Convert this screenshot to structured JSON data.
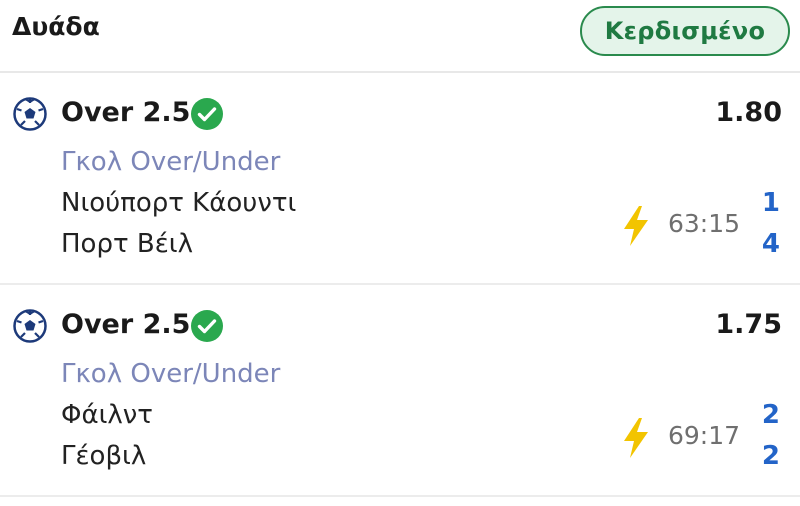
{
  "header": {
    "title": "Δυάδα",
    "status": "Κερδισμένο"
  },
  "colors": {
    "status_green": "#1f7a42",
    "check_green": "#2aa84e",
    "market_text": "#7c86b8",
    "score_blue": "#2364c8",
    "bolt_yellow": "#f2c400"
  },
  "bets": [
    {
      "sport_icon": "soccer-ball-icon",
      "selection": "Over 2.5",
      "result_icon": "check-circle-icon",
      "odds": "1.80",
      "market": "Γκολ Over/Under",
      "home_team": "Νιούπορτ Κάουντι",
      "away_team": "Πορτ Βέιλ",
      "live_icon": "lightning-icon",
      "time": "63:15",
      "home_score": "1",
      "away_score": "4"
    },
    {
      "sport_icon": "soccer-ball-icon",
      "selection": "Over 2.5",
      "result_icon": "check-circle-icon",
      "odds": "1.75",
      "market": "Γκολ Over/Under",
      "home_team": "Φάιλντ",
      "away_team": "Γέοβιλ",
      "live_icon": "lightning-icon",
      "time": "69:17",
      "home_score": "2",
      "away_score": "2"
    }
  ]
}
